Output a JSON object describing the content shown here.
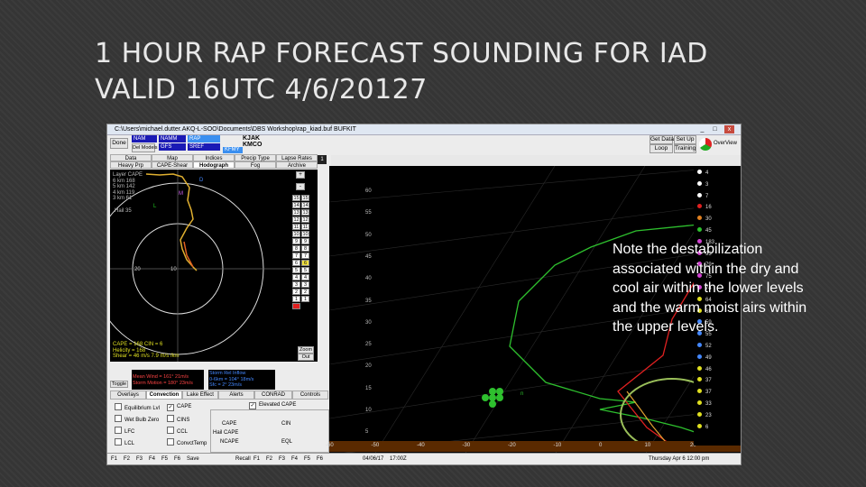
{
  "slide": {
    "title_line1": "1 HOUR RAP FORECAST SOUNDING FOR IAD",
    "title_line2": "VALID 16UTC 4/6/20127",
    "note": "Note the destabilization associated within the dry and cool air within the lower levels and the warm moist airs within the upper levels."
  },
  "window": {
    "title": "C:\\Users\\michael.dutter.AKQ-L-SOO\\Documents\\DBS Workshop\\rap_kiad.buf BUFKIT",
    "minimize": "_",
    "maximize": "□",
    "close": "x"
  },
  "toolbar": {
    "done": "Done",
    "del_models": "Del Models",
    "model_boxes": [
      "NAM",
      "NAMM",
      "RAP",
      "GFS",
      "",
      "SREF",
      ""
    ],
    "stations": [
      "KJAK",
      "KMCO"
    ],
    "selected_station": "KFMY",
    "get_data": "Get Data",
    "set_up": "Set Up",
    "loop": "Loop",
    "training": "Training",
    "overview": "OverView",
    "counter": "1"
  },
  "tabs_top": [
    "Data",
    "Map",
    "Indices",
    "Precip Type",
    "Lapse Rates"
  ],
  "tabs_bottom": [
    "Heavy Prp",
    "CAPE-Shear",
    "Hodograph",
    "Fog",
    "Archive"
  ],
  "selected_tab": "Hodograph",
  "hodograph": {
    "layer_title": "Layer CAPE",
    "layer_rows": [
      "6 km  168",
      "5 km  142",
      "4 km  119",
      "3 km  61"
    ],
    "hail": "Hail  35",
    "ring_labels": [
      "20",
      "10"
    ],
    "marker_labels": [
      "M",
      "L",
      "D"
    ],
    "cape_line": "CAPE = 168  CIN = 6",
    "helicity_line": "Helicity = 168",
    "shear_line": "Shear = 46 m/s  7.9 m/s /km",
    "zoom": "Zoom",
    "out": "Out",
    "level_numbers": [
      "15",
      "14",
      "13",
      "12",
      "11",
      "10",
      "9",
      "8",
      "7",
      "6",
      "5",
      "4",
      "3",
      "2",
      "1"
    ],
    "highlight_level": "6",
    "plus": "+",
    "minus": "-"
  },
  "wind_box": {
    "toggle": "Toggle",
    "mean_wind": "Mean Wind = 161° 21m/s",
    "storm_motion": "Storm Motion = 180° 23m/s",
    "storm_rel_title": "Storm Rel Inflow",
    "storm_rel_1": "0-6km = 104° 18m/s",
    "storm_rel_2": "Sfc = 2° 23m/s"
  },
  "lower_tabs": [
    "Overlays",
    "Convection",
    "Lake Effect",
    "Alerts",
    "CONRAD",
    "Controls"
  ],
  "selected_lower_tab": "Convection",
  "checkboxes_left": [
    "Equilibrium Lvl",
    "Wet Bulb Zero",
    "LFC",
    "LCL"
  ],
  "checkboxes_mid": [
    "CAPE",
    "CINS",
    "CCL",
    "ConvctTemp"
  ],
  "checked": [
    "CAPE"
  ],
  "elevated": {
    "label": "Elevated CAPE",
    "checked": true
  },
  "cape_fields": [
    "CAPE",
    "CIN",
    "Hail CAPE",
    "NCAPE",
    "EQL"
  ],
  "fkeys_left": [
    "F1",
    "F2",
    "F3",
    "F4",
    "F5",
    "F6",
    "Save"
  ],
  "fkeys_right": [
    "Recall",
    "F1",
    "F2",
    "F3",
    "F4",
    "F5",
    "F6"
  ],
  "skewt": {
    "height_labels": [
      "60",
      "55",
      "50",
      "45",
      "40",
      "35",
      "30",
      "25",
      "20",
      "15",
      "10",
      "5"
    ],
    "temp_labels": [
      "-60",
      "-50",
      "-40",
      "-30",
      "-20",
      "-10",
      "0",
      "10",
      "20"
    ],
    "side_labels": [
      "4",
      "3",
      "7",
      "16",
      "30",
      "45",
      "183",
      "93",
      "79",
      "75",
      "74",
      "64",
      "68",
      "59",
      "55",
      "52",
      "49",
      "46",
      "37",
      "37",
      "33",
      "23",
      "6"
    ],
    "small_label": "n"
  },
  "status_bar": {
    "left": "-50",
    "date": "04/06/17",
    "time": "17:00Z",
    "right": "Thursday    Apr 6 12:00 pm"
  },
  "colors": {
    "sounding_temp": "#e02020",
    "sounding_dew": "#2ec02e",
    "hodo_line": "#e0b030",
    "ellipse": "#9abf5a"
  }
}
